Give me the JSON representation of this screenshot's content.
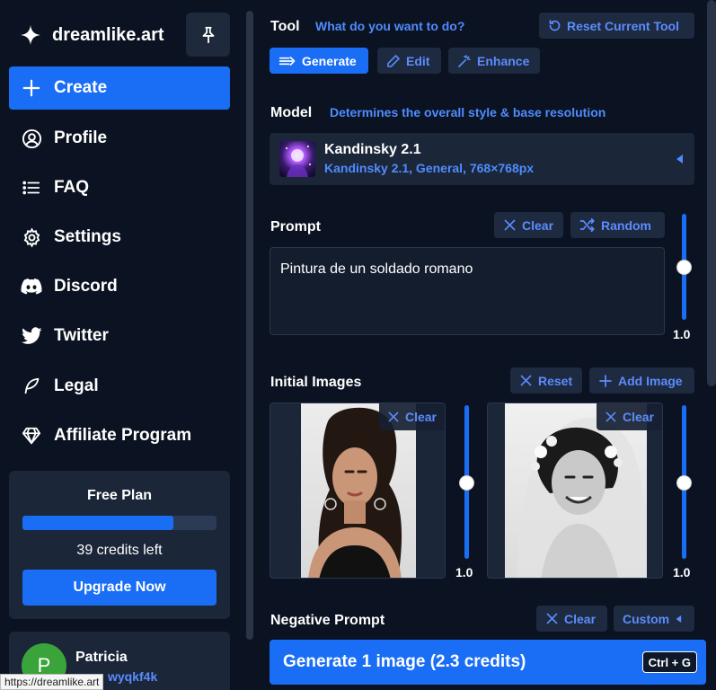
{
  "brand": {
    "name": "dreamlike.art"
  },
  "nav": [
    {
      "id": "create",
      "label": "Create",
      "active": true
    },
    {
      "id": "profile",
      "label": "Profile"
    },
    {
      "id": "faq",
      "label": "FAQ"
    },
    {
      "id": "settings",
      "label": "Settings"
    },
    {
      "id": "discord",
      "label": "Discord"
    },
    {
      "id": "twitter",
      "label": "Twitter"
    },
    {
      "id": "legal",
      "label": "Legal"
    },
    {
      "id": "affiliate",
      "label": "Affiliate Program"
    }
  ],
  "plan": {
    "title": "Free Plan",
    "progress_percent": 78,
    "credits_text": "39 credits left",
    "upgrade_label": "Upgrade Now"
  },
  "user": {
    "name": "Patricia",
    "initial": "P",
    "handle": "wyqkf4k"
  },
  "status_url": "https://dreamlike.art",
  "tool": {
    "title": "Tool",
    "hint": "What do you want to do?",
    "reset_label": "Reset Current Tool",
    "modes": [
      "Generate",
      "Edit",
      "Enhance"
    ],
    "active_mode": "Generate"
  },
  "model": {
    "title": "Model",
    "hint": "Determines the overall style & base resolution",
    "name": "Kandinsky 2.1",
    "desc": "Kandinsky 2.1, General, 768×768px"
  },
  "prompt": {
    "title": "Prompt",
    "clear_label": "Clear",
    "random_label": "Random",
    "value": "Pintura de un soldado romano",
    "weight": "1.0"
  },
  "initial_images": {
    "title": "Initial Images",
    "reset_label": "Reset",
    "add_label": "Add Image",
    "items": [
      {
        "clear_label": "Clear",
        "weight": "1.0"
      },
      {
        "clear_label": "Clear",
        "weight": "1.0"
      }
    ]
  },
  "negative_prompt": {
    "title": "Negative Prompt",
    "clear_label": "Clear",
    "custom_label": "Custom"
  },
  "generate": {
    "label": "Generate 1 image (2.3 credits)",
    "shortcut": "Ctrl + G"
  },
  "colors": {
    "accent": "#1a6ef5",
    "link": "#4f8cff",
    "background": "#0b1221",
    "panel": "#1b2639"
  }
}
